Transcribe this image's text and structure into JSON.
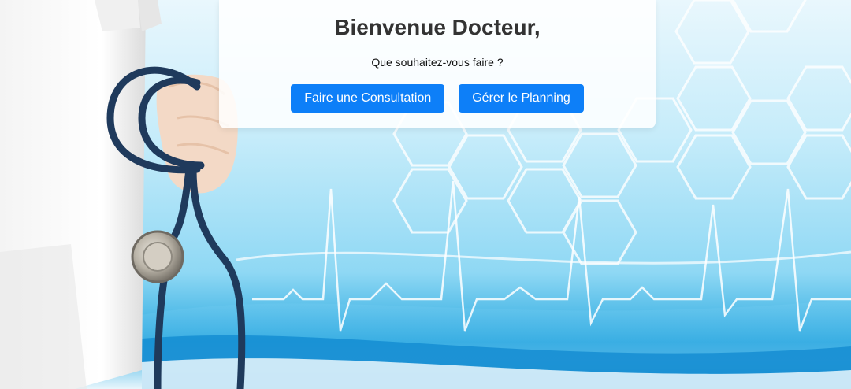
{
  "welcome": {
    "title": "Bienvenue Docteur,",
    "subtitle": "Que souhaitez-vous faire ?"
  },
  "actions": {
    "consultation_label": "Faire une Consultation",
    "planning_label": "Gérer le Planning"
  },
  "colors": {
    "button_primary": "#0d7ff8",
    "title_text": "#333333",
    "background_accent": "#2aa9e0"
  },
  "icons": [
    "stethoscope-illustration",
    "hexagon-pattern",
    "heartbeat-line"
  ]
}
